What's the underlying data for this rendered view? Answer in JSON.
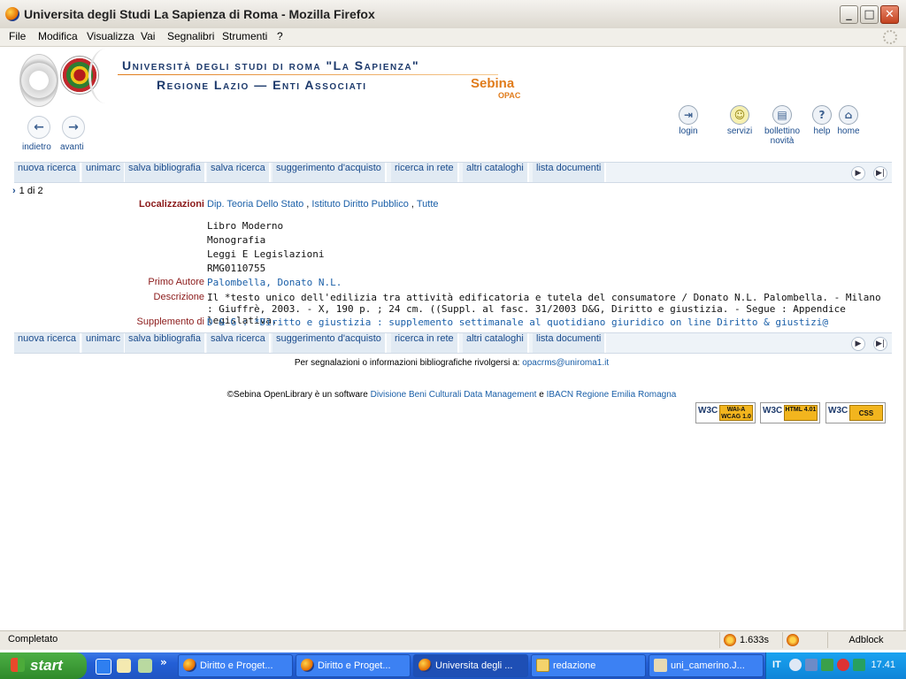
{
  "window": {
    "title": "Universita degli Studi La Sapienza di Roma - Mozilla Firefox"
  },
  "menu": [
    "File",
    "Modifica",
    "Visualizza",
    "Vai",
    "Segnalibri",
    "Strumenti",
    "?"
  ],
  "header": {
    "line1": "Università degli studi di roma \"La Sapienza\"",
    "line2": "Regione Lazio — Enti Associati",
    "brand": "Sebina",
    "brand_sub": "OPAC"
  },
  "top_icons": [
    {
      "label": "login",
      "icon": "login-icon"
    },
    {
      "label": "servizi",
      "icon": "smiley-icon"
    },
    {
      "label": "bollettino novità",
      "icon": "newsletter-icon"
    },
    {
      "label": "help",
      "icon": "help-icon"
    },
    {
      "label": "home",
      "icon": "home-icon"
    }
  ],
  "nav": {
    "back": "indietro",
    "forward": "avanti"
  },
  "toolbar": [
    "nuova ricerca",
    "unimarc",
    "salva bibliografia",
    "salva ricerca",
    "suggerimento d'acquisto",
    "ricerca in rete",
    "altri cataloghi",
    "lista documenti"
  ],
  "pager": "1 di 2",
  "record": {
    "loc_label": "Localizzazioni",
    "localizzazioni": [
      "Dip. Teoria Dello Stato",
      "Istituto Diritto Pubblico",
      "Tutte"
    ],
    "lines": [
      "Libro Moderno",
      "Monografia",
      "Leggi E Legislazioni",
      "RMG0110755"
    ],
    "author_label": "Primo Autore",
    "author": "Palombella, Donato N.L.",
    "desc_label": "Descrizione",
    "description": "Il *testo unico dell'edilizia tra attività edificatoria e tutela del consumatore / Donato N.L. Palombella. - Milano : Giuffrè, 2003. - X, 190 p. ; 24 cm. ((Suppl. al fasc. 31/2003 D&G, Diritto e giustizia. - Segue : Appendice legislativa.",
    "supp_label": "Supplemento di",
    "supplement": "D & G : *Diritto e giustizia : supplemento settimanale al quotidiano giuridico on line Diritto & giustizi@"
  },
  "footer": {
    "contact_text": "Per segnalazioni o informazioni bibliografiche rivolgersi a:",
    "email": "opacrms@uniroma1.it",
    "credits_prefix": "©Sebina OpenLibrary è un software",
    "credits_link1": "Divisione Beni Culturali Data Management",
    "credits_and": "e",
    "credits_link2": "IBACN Regione Emilia Romagna",
    "badges": [
      {
        "w3c": "W3C",
        "text": "WAI-A WCAG 1.0"
      },
      {
        "w3c": "W3C",
        "text": "HTML 4.01"
      },
      {
        "w3c": "W3C",
        "text": "CSS"
      }
    ]
  },
  "status": {
    "text": "Completato",
    "time": "1.633s",
    "adblock": "Adblock"
  },
  "taskbar": {
    "start": "start",
    "tasks": [
      {
        "label": "Diritto e Proget...",
        "icon": "firefox-icon"
      },
      {
        "label": "Diritto e Proget...",
        "icon": "firefox-icon"
      },
      {
        "label": "Universita degli ...",
        "icon": "firefox-icon",
        "active": true
      },
      {
        "label": "redazione",
        "icon": "folder-icon"
      },
      {
        "label": "uni_camerino.J...",
        "icon": "image-icon"
      }
    ],
    "lang": "IT",
    "clock": "17.41"
  },
  "colors": {
    "accent": "#1a4b8c",
    "label_red": "#8b1a1a",
    "orange": "#e07b1a"
  }
}
